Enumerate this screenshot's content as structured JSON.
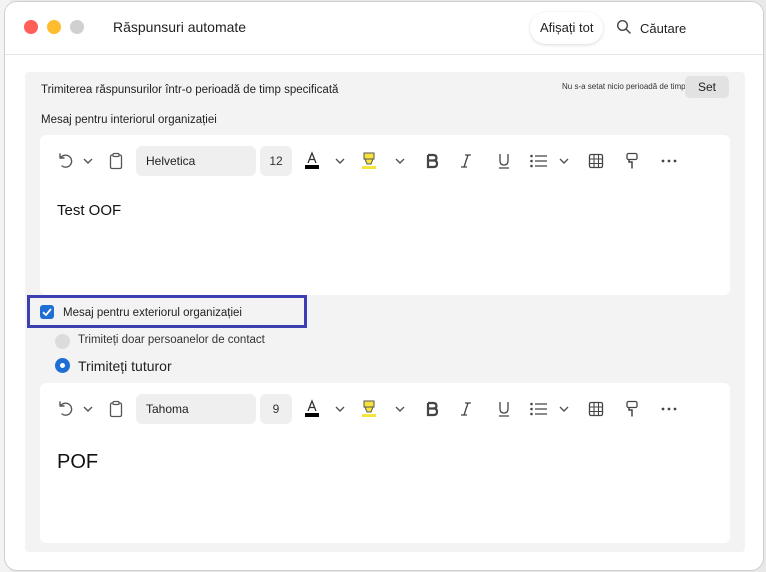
{
  "window": {
    "title": "Răspunsuri automate"
  },
  "header": {
    "show_all": "Afișați tot",
    "search_label": "Căutare"
  },
  "period": {
    "label": "Trimiterea răspunsurilor într-o perioadă de timp specificată",
    "status": "Nu s-a setat nicio perioadă de timp",
    "set_button": "Set"
  },
  "inside": {
    "label": "Mesaj pentru interiorul organizației",
    "font": "Helvetica",
    "size": "12",
    "body": "Test OOF"
  },
  "outside": {
    "checkbox_label": "Mesaj pentru exteriorul organizației",
    "checked": true,
    "radio_contacts": "Trimiteți doar persoanelor de contact",
    "radio_all": "Trimiteți tuturor",
    "selected": "radio_all",
    "font": "Tahoma",
    "size": "9",
    "body": "POF"
  },
  "colors": {
    "accent": "#1f6ed4",
    "highlight": "#3b3fb0",
    "highlighter": "#f7e43a"
  },
  "icons": [
    "undo-icon",
    "chevron-down-icon",
    "clipboard-icon",
    "font-color-icon",
    "highlighter-icon",
    "bold-icon",
    "italic-icon",
    "underline-icon",
    "bullet-list-icon",
    "table-icon",
    "format-painter-icon",
    "more-icon",
    "search-icon"
  ]
}
